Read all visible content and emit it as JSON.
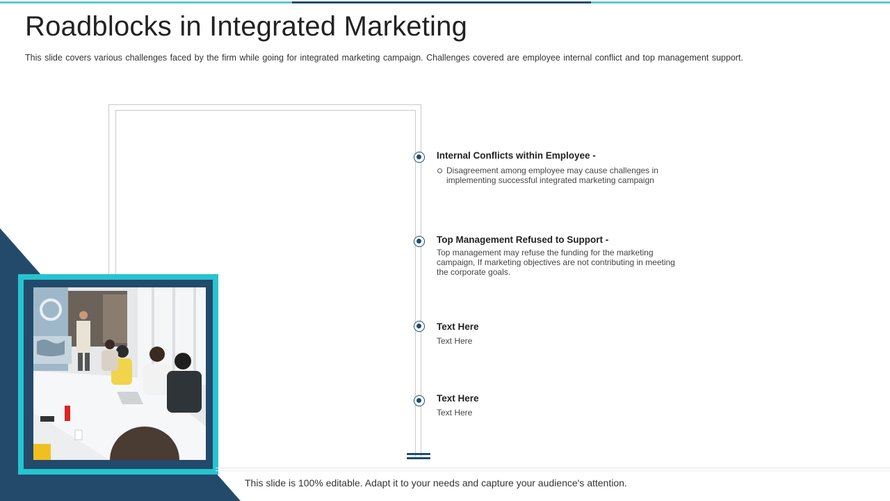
{
  "slide": {
    "title": "Roadblocks in Integrated Marketing",
    "subtitle": "This slide covers various challenges faced by the firm while going for integrated marketing campaign. Challenges covered are employee internal conflict and top management support."
  },
  "items": [
    {
      "heading": "Internal Conflicts within Employee -",
      "lines": [
        "Disagreement among employee may cause challenges in",
        "implementing successful integrated marketing campaign"
      ]
    },
    {
      "heading": "Top Management Refused to Support -",
      "lines": [
        "Top management may refuse the funding for the marketing",
        "campaign, If marketing objectives are not contributing in meeting",
        "the corporate goals."
      ]
    },
    {
      "heading": "Text Here",
      "lines": [
        "Text Here"
      ]
    },
    {
      "heading": "Text Here",
      "lines": [
        "Text Here"
      ]
    }
  ],
  "footer": "This slide is 100% editable. Adapt it to your needs and capture your audience's attention.",
  "colors": {
    "accent_teal": "#26c4cf",
    "navy": "#1e4b6e",
    "dark_triangle": "#234a6b"
  }
}
